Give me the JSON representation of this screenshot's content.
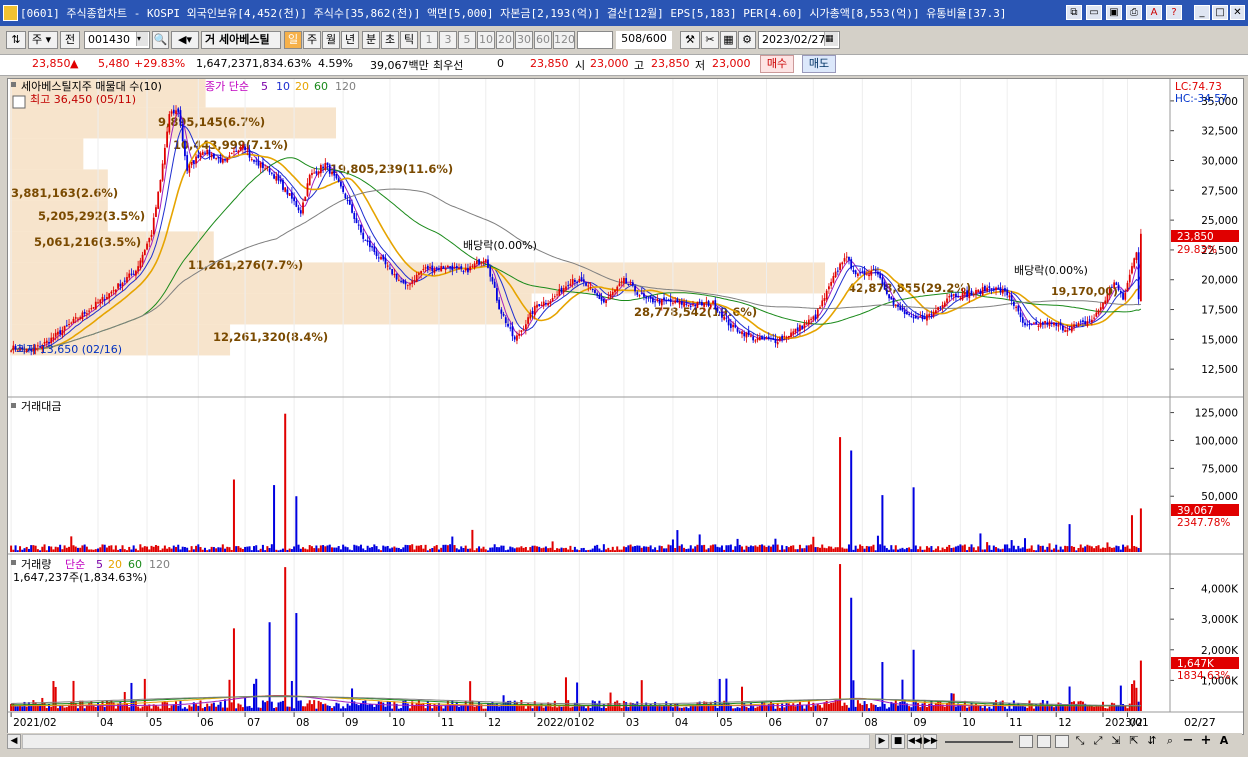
{
  "window": {
    "title": "[0601] 주식종합차트 - KOSPI 외국인보유[4,452(천)] 주식수[35,862(천)] 액면[5,000] 자본금[2,193(억)] 결산[12월] EPS[5,183] PER[4.60] 시가총액[8,553(억)] 유통비율[37.3]"
  },
  "toolbar": {
    "market": "주",
    "all": "전",
    "code": "001430",
    "stock_prefix": "거",
    "stock_name": "세아베스틸",
    "periods": [
      "일",
      "주",
      "월",
      "년",
      "분",
      "초",
      "틱"
    ],
    "active_period": "일",
    "minute_units": [
      "1",
      "3",
      "5",
      "10",
      "20",
      "30",
      "60",
      "120"
    ],
    "count": "508",
    "count_total": "/600",
    "date": "2023/02/27"
  },
  "quote": {
    "price": "23,850",
    "change": "5,480",
    "change_pct": "+29.83%",
    "volume": "1,647,237",
    "volume_pct": "1,834.63%",
    "turnover": "4.59%",
    "amount": "39,067백만",
    "best_bid_label": "최우선",
    "best_bid": "0",
    "last": "23,850",
    "open_label": "시",
    "open": "23,000",
    "high_label": "고",
    "high": "23,850",
    "low_label": "저",
    "low": "23,000",
    "buy": "매수",
    "sell": "매도"
  },
  "price_panel": {
    "title": "세아베스틸지주 매물대 수(10)",
    "ma_label": "종가 단순",
    "ma_periods": [
      "5",
      "10",
      "20",
      "60",
      "120"
    ],
    "lc": "LC:74.73",
    "hc": "HC:-34.57",
    "high_note": "최고 36,450 (05/11)",
    "low_note": "최저 13,650 (02/16)",
    "dividend1": "배당락(0.00%)",
    "dividend2": "배당락(0.00%)",
    "last_price_tag": "23,850",
    "last_pct_tag": "29.83%",
    "profile_labels": [
      "12,261,320(8.4%)",
      "28,778,542(19.6%)",
      "42,878,855(29.2%)",
      "11,261,276(7.7%)",
      "5,061,216(3.5%)",
      "5,205,292(3.5%)",
      "3,881,163(2.6%)",
      "19,805,239(11.6%)",
      "10,443,999(7.1%)",
      "9,895,145(6.7%)"
    ],
    "extra_label": "19,170,00)"
  },
  "amount_panel": {
    "title": "거래대금",
    "tag_value": "39,067",
    "tag_pct": "2347.78%"
  },
  "volume_panel": {
    "title": "거래량",
    "ma_label": "단순",
    "ma_periods": [
      "5",
      "20",
      "60",
      "120"
    ],
    "current": "1,647,237주(1,834.63%)",
    "tag_value": "1,647K",
    "tag_pct": "1834.63%"
  },
  "xaxis": {
    "labels": [
      "2021/02",
      "04",
      "05",
      "06",
      "07",
      "08",
      "09",
      "10",
      "11",
      "12",
      "2022/01",
      "02",
      "03",
      "04",
      "05",
      "06",
      "07",
      "08",
      "09",
      "10",
      "11",
      "12",
      "2023/01",
      "02"
    ],
    "right_label": "02/27"
  },
  "chart_data": {
    "type": "candlestick",
    "price_axis": {
      "ticks": [
        12500,
        15000,
        17500,
        20000,
        22500,
        25000,
        27500,
        30000,
        32500,
        35000
      ],
      "labels": [
        "12,500",
        "15,000",
        "17,500",
        "20,000",
        "22,500",
        "25,000",
        "27,500",
        "30,000",
        "32,500",
        "35,000"
      ],
      "range": [
        10500,
        36500
      ]
    },
    "amount_axis": {
      "ticks": [
        50000,
        75000,
        100000,
        125000
      ],
      "labels": [
        "50,000",
        "75,000",
        "100,000",
        "125,000"
      ],
      "range": [
        0,
        130000
      ]
    },
    "volume_axis": {
      "ticks": [
        1000,
        2000,
        3000,
        4000
      ],
      "labels": [
        "1,000K",
        "2,000K",
        "3,000K",
        "4,000K"
      ],
      "range": [
        0,
        4900
      ]
    },
    "close_anchors": [
      [
        0,
        14300
      ],
      [
        9,
        14000
      ],
      [
        17,
        14900
      ],
      [
        30,
        16800
      ],
      [
        42,
        18500
      ],
      [
        56,
        20800
      ],
      [
        63,
        23900
      ],
      [
        67,
        28300
      ],
      [
        71,
        33800
      ],
      [
        75,
        34200
      ],
      [
        79,
        29200
      ],
      [
        86,
        30900
      ],
      [
        96,
        29800
      ],
      [
        104,
        31500
      ],
      [
        108,
        30000
      ],
      [
        116,
        29200
      ],
      [
        124,
        27300
      ],
      [
        130,
        25700
      ],
      [
        134,
        28700
      ],
      [
        141,
        29700
      ],
      [
        149,
        27400
      ],
      [
        158,
        23500
      ],
      [
        169,
        21000
      ],
      [
        177,
        19400
      ],
      [
        185,
        20900
      ],
      [
        197,
        21100
      ],
      [
        203,
        20600
      ],
      [
        213,
        21900
      ],
      [
        219,
        17700
      ],
      [
        226,
        14900
      ],
      [
        236,
        17900
      ],
      [
        243,
        18400
      ],
      [
        252,
        20100
      ],
      [
        257,
        19700
      ],
      [
        266,
        18100
      ],
      [
        275,
        19900
      ],
      [
        285,
        18300
      ],
      [
        297,
        18100
      ],
      [
        306,
        17900
      ],
      [
        315,
        18000
      ],
      [
        323,
        16100
      ],
      [
        334,
        15000
      ],
      [
        343,
        14900
      ],
      [
        351,
        15600
      ],
      [
        361,
        16900
      ],
      [
        370,
        20500
      ],
      [
        374,
        22000
      ],
      [
        380,
        20300
      ],
      [
        388,
        20900
      ],
      [
        396,
        17900
      ],
      [
        405,
        16600
      ],
      [
        413,
        17100
      ],
      [
        421,
        18700
      ],
      [
        431,
        18800
      ],
      [
        440,
        19400
      ],
      [
        448,
        18700
      ],
      [
        455,
        16000
      ],
      [
        465,
        16400
      ],
      [
        473,
        15900
      ],
      [
        481,
        16300
      ],
      [
        486,
        16800
      ],
      [
        492,
        18700
      ],
      [
        495,
        19900
      ],
      [
        499,
        18300
      ],
      [
        507,
        23850
      ]
    ],
    "amount_spikes": [
      [
        100,
        65000
      ],
      [
        118,
        60000
      ],
      [
        123,
        124000
      ],
      [
        128,
        50000
      ],
      [
        372,
        103000
      ],
      [
        377,
        91000
      ],
      [
        391,
        51000
      ],
      [
        405,
        58000
      ],
      [
        475,
        25000
      ],
      [
        503,
        33000
      ],
      [
        507,
        39067
      ]
    ],
    "volume_spikes": [
      [
        100,
        2700
      ],
      [
        116,
        2900
      ],
      [
        123,
        4700
      ],
      [
        128,
        3200
      ],
      [
        249,
        1100
      ],
      [
        372,
        4800
      ],
      [
        377,
        3700
      ],
      [
        391,
        1600
      ],
      [
        405,
        2000
      ],
      [
        475,
        800
      ],
      [
        504,
        1000
      ],
      [
        507,
        1647
      ]
    ]
  }
}
